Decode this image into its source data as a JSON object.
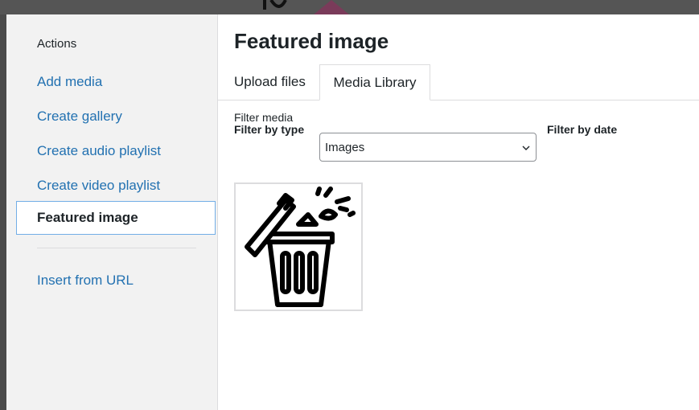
{
  "sidebar": {
    "heading": "Actions",
    "items": [
      {
        "label": "Add media"
      },
      {
        "label": "Create gallery"
      },
      {
        "label": "Create audio playlist"
      },
      {
        "label": "Create video playlist"
      },
      {
        "label": "Featured image"
      },
      {
        "label": "Insert from URL"
      }
    ]
  },
  "main": {
    "title": "Featured image",
    "tabs": [
      {
        "label": "Upload files"
      },
      {
        "label": "Media Library"
      }
    ],
    "filters": {
      "heading": "Filter media",
      "type_label": "Filter by type",
      "type_value": "Images",
      "date_label": "Filter by date"
    },
    "attachments": [
      {
        "icon": "trash-can-icon"
      }
    ]
  },
  "colors": {
    "link": "#2271b1",
    "text": "#1d2327",
    "sidebar_bg": "#f2f2f2",
    "active_border": "#72aee6"
  }
}
